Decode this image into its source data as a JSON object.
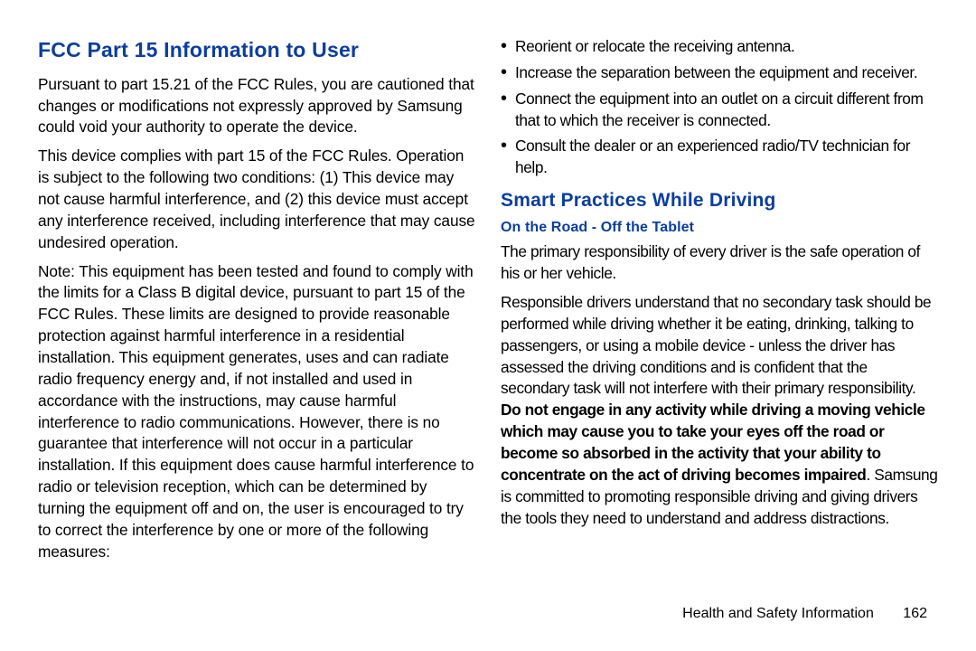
{
  "left": {
    "title": "FCC Part 15 Information to User",
    "p1": "Pursuant to part 15.21 of the FCC Rules, you are cautioned that changes or modifications not expressly approved by Samsung could void your authority to operate the device.",
    "p2": "This device complies with part 15 of the FCC Rules. Operation is subject to the following two conditions: (1) This device may not cause harmful interference, and (2) this device must accept any interference received, including interference that may cause undesired operation.",
    "p3": "Note: This equipment has been tested and found to comply with the limits for a Class B digital device, pursuant to part 15 of the FCC Rules. These limits are designed to provide reasonable protection against harmful interference in a residential installation. This equipment generates, uses and can radiate radio frequency energy and, if not installed and used in accordance with the instructions, may cause harmful interference to radio communications. However, there is no guarantee that interference will not occur in a particular installation. If this equipment does cause harmful interference to radio or television reception, which can be determined by turning the equipment off and on, the user is encouraged to try to correct the interference by one or more of the following measures:"
  },
  "right": {
    "bullets": [
      "Reorient or relocate the receiving antenna.",
      "Increase the separation between the equipment and receiver.",
      "Connect the equipment into an outlet on a circuit different from that to which the receiver is connected.",
      "Consult the dealer or an experienced radio/TV technician for help."
    ],
    "title": "Smart Practices While Driving",
    "subtitle": "On the Road - Off the Tablet",
    "p1": "The primary responsibility of every driver is the safe operation of his or her vehicle.",
    "p2_a": "Responsible drivers understand that no secondary task should be performed while driving whether it be eating, drinking, talking to passengers, or using a mobile device - unless the driver has assessed the driving conditions and is confident that the secondary task will not interfere with their primary responsibility. ",
    "p2_bold": "Do not engage in any activity while driving a moving vehicle which may cause you to take your eyes off the road or become so absorbed in the activity that your ability to concentrate on the act of driving becomes impaired",
    "p2_b": ". Samsung is committed to promoting responsible driving and giving drivers the tools they need to understand and address distractions."
  },
  "footer": {
    "section": "Health and Safety Information",
    "page": "162"
  }
}
